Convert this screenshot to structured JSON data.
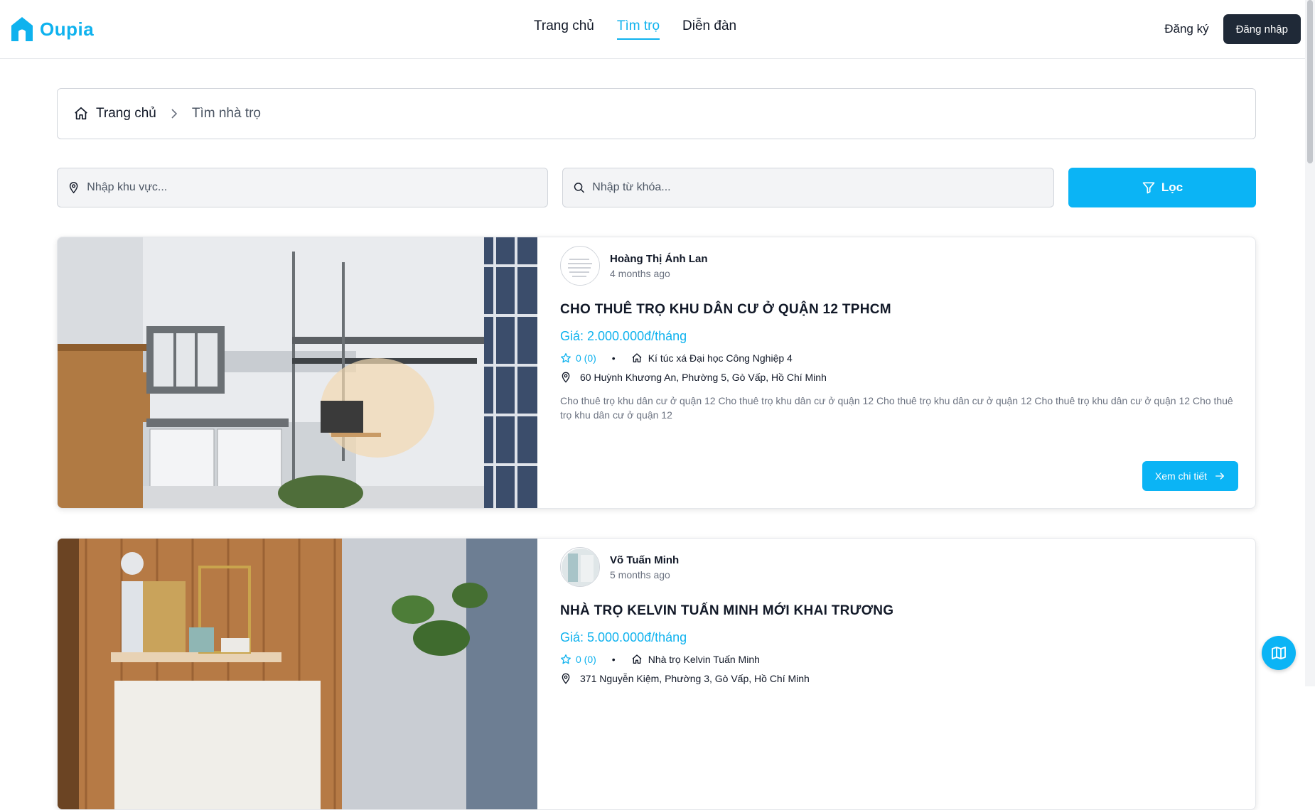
{
  "brand": {
    "name": "Oupia",
    "accent": "#0fb2ee"
  },
  "nav": {
    "items": [
      {
        "label": "Trang chủ",
        "active": false
      },
      {
        "label": "Tìm trọ",
        "active": true
      },
      {
        "label": "Diễn đàn",
        "active": false
      }
    ]
  },
  "auth": {
    "register": "Đăng ký",
    "login": "Đăng nhập"
  },
  "breadcrumb": {
    "home": "Trang chủ",
    "current": "Tìm nhà trọ"
  },
  "search": {
    "location_placeholder": "Nhập khu vực...",
    "keyword_placeholder": "Nhập từ khóa...",
    "filter_label": "Lọc"
  },
  "listings": [
    {
      "author": "Hoàng Thị Ánh Lan",
      "time": "4 months ago",
      "title": "CHO THUÊ TRỌ KHU DÂN CƯ Ở QUẬN 12 TPHCM",
      "price": "Giá: 2.000.000đ/tháng",
      "rating": "0 (0)",
      "property": "Kí túc xá Đại học Công Nghiệp 4",
      "address": "60 Huỳnh Khương An, Phường 5, Gò Vấp, Hồ Chí Minh",
      "description": "Cho thuê trọ khu dân cư ở quận 12 Cho thuê trọ khu dân cư ở quận 12 Cho thuê trọ khu dân cư ở quận 12 Cho thuê trọ khu dân cư ở quận 12 Cho thuê trọ khu dân cư ở quận 12",
      "button": "Xem chi tiết"
    },
    {
      "author": "Võ Tuấn Minh",
      "time": "5 months ago",
      "title": "NHÀ TRỌ KELVIN TUẤN MINH MỚI KHAI TRƯƠNG",
      "price": "Giá: 5.000.000đ/tháng",
      "rating": "0 (0)",
      "property": "Nhà trọ Kelvin Tuấn Minh",
      "address": "371 Nguyễn Kiệm, Phường 3, Gò Vấp, Hồ Chí Minh"
    }
  ]
}
